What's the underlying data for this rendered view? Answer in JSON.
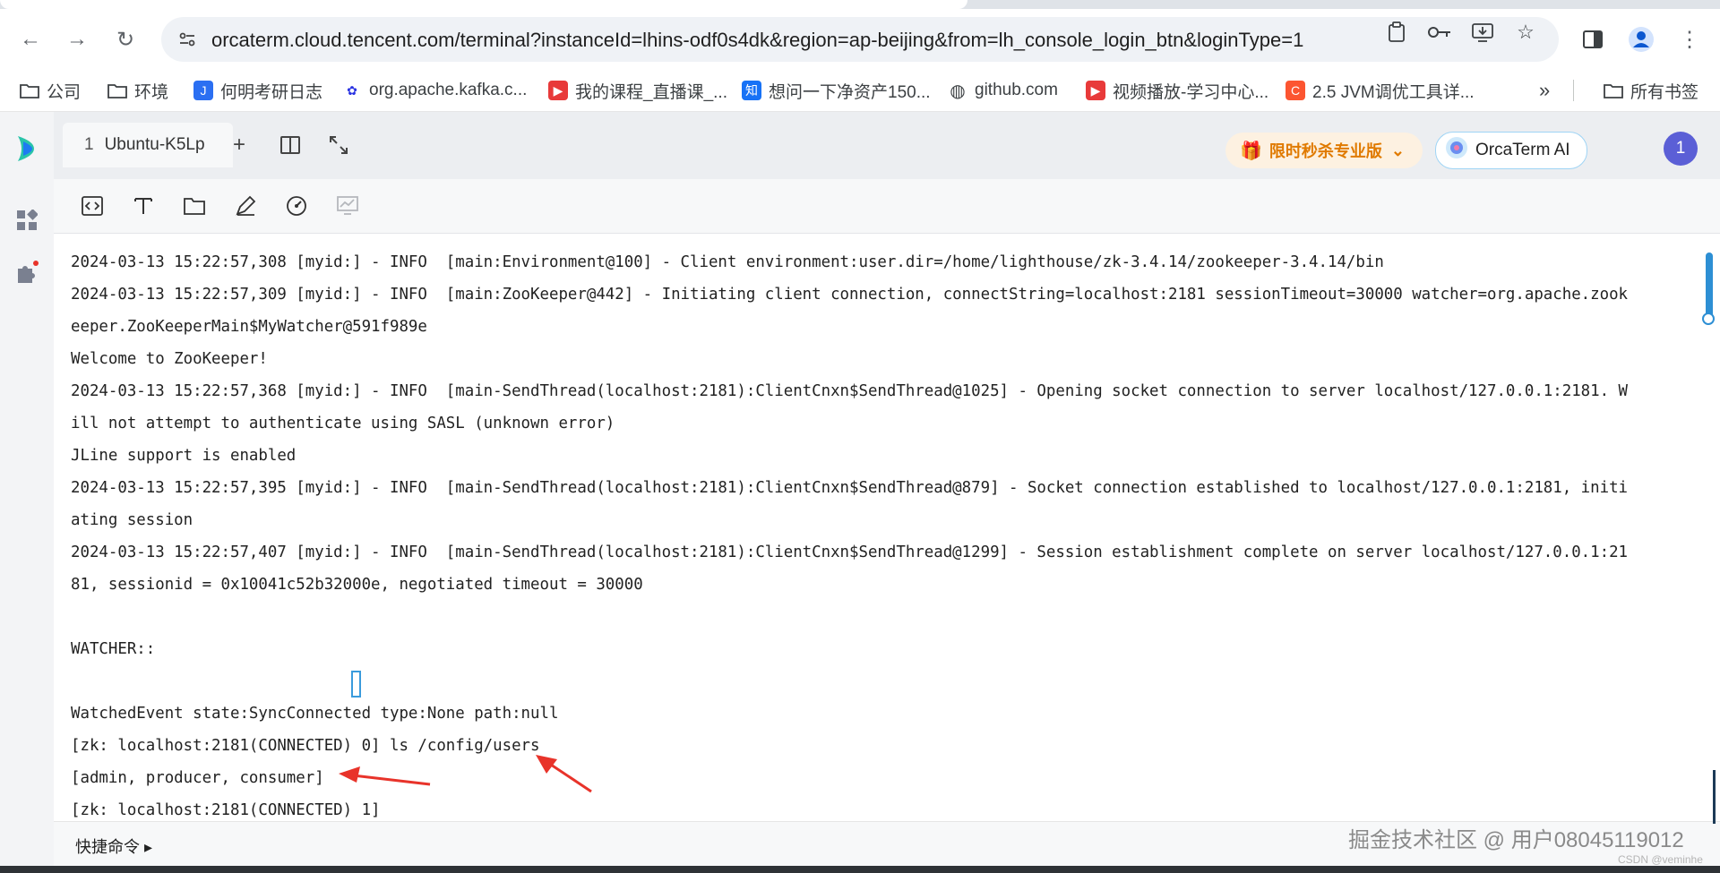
{
  "browser": {
    "url": "orcaterm.cloud.tencent.com/terminal?instanceId=lhins-odf0s4dk&region=ap-beijing&from=lh_console_login_btn&loginType=1",
    "bookmarks": [
      {
        "label": "公司",
        "icon": "folder-icon"
      },
      {
        "label": "环境",
        "icon": "folder-icon"
      },
      {
        "label": "何明考研日志",
        "icon": "notes-icon"
      },
      {
        "label": "org.apache.kafka.c...",
        "icon": "baidu-paw-icon"
      },
      {
        "label": "我的课程_直播课_...",
        "icon": "video-icon"
      },
      {
        "label": "想问一下净资产150...",
        "icon": "zhihu-icon"
      },
      {
        "label": "github.com",
        "icon": "globe-icon"
      },
      {
        "label": "视频播放-学习中心...",
        "icon": "video-icon"
      },
      {
        "label": "2.5 JVM调优工具详...",
        "icon": "csdn-icon"
      }
    ],
    "all_bookmarks_label": "所有书签"
  },
  "app": {
    "tab_index": "1",
    "tab_label": "Ubuntu-K5Lp",
    "promo_label": "限时秒杀专业版",
    "ai_label": "OrcaTerm AI",
    "avatar_initial": "1",
    "quick_commands_label": "快捷命令 ▸"
  },
  "terminal": {
    "lines": [
      "2024-03-13 15:22:57,308 [myid:] - INFO  [main:Environment@100] - Client environment:user.dir=/home/lighthouse/zk-3.4.14/zookeeper-3.4.14/bin",
      "2024-03-13 15:22:57,309 [myid:] - INFO  [main:ZooKeeper@442] - Initiating client connection, connectString=localhost:2181 sessionTimeout=30000 watcher=org.apache.zook",
      "eeper.ZooKeeperMain$MyWatcher@591f989e",
      "Welcome to ZooKeeper!",
      "2024-03-13 15:22:57,368 [myid:] - INFO  [main-SendThread(localhost:2181):ClientCnxn$SendThread@1025] - Opening socket connection to server localhost/127.0.0.1:2181. W",
      "ill not attempt to authenticate using SASL (unknown error)",
      "JLine support is enabled",
      "2024-03-13 15:22:57,395 [myid:] - INFO  [main-SendThread(localhost:2181):ClientCnxn$SendThread@879] - Socket connection established to localhost/127.0.0.1:2181, initi",
      "ating session",
      "2024-03-13 15:22:57,407 [myid:] - INFO  [main-SendThread(localhost:2181):ClientCnxn$SendThread@1299] - Session establishment complete on server localhost/127.0.0.1:21",
      "81, sessionid = 0x10041c52b32000e, negotiated timeout = 30000",
      "",
      "WATCHER::",
      "",
      "WatchedEvent state:SyncConnected type:None path:null",
      "[zk: localhost:2181(CONNECTED) 0] ls /config/users",
      "[admin, producer, consumer]",
      "[zk: localhost:2181(CONNECTED) 1] "
    ]
  },
  "watermark": {
    "text": "掘金技术社区 @ 用户08045119012",
    "small": "CSDN @veminhe"
  },
  "colors": {
    "accent": "#2d8fd4",
    "promo": "#e07a00",
    "annotation_arrow": "#e8332a"
  }
}
